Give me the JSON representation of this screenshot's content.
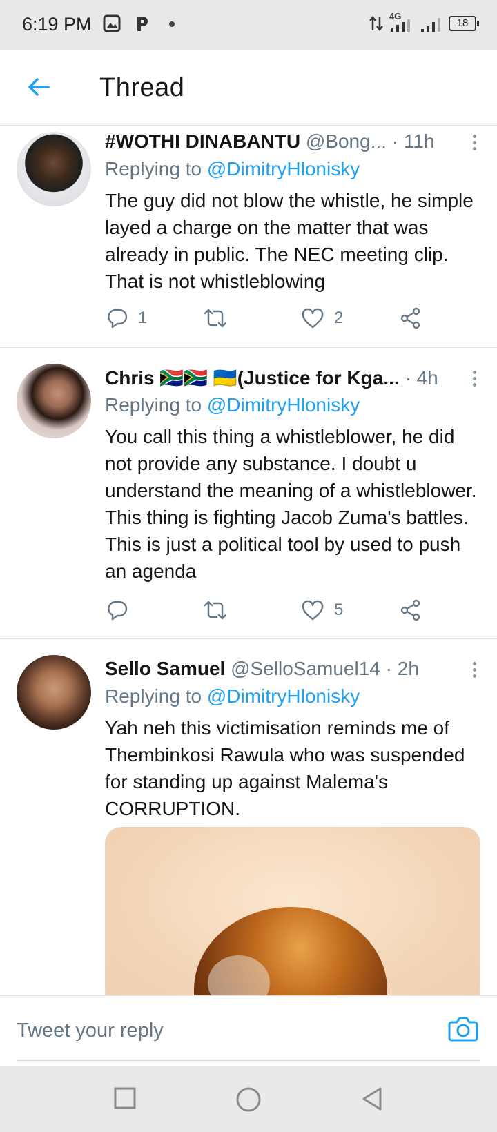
{
  "status_bar": {
    "time": "6:19 PM",
    "network": "4G",
    "battery": "18",
    "icons": [
      "gallery-icon",
      "p-icon",
      "dot-icon",
      "data-arrows-icon",
      "signal-icon",
      "signal-icon-2",
      "battery-icon"
    ]
  },
  "header": {
    "title": "Thread",
    "back_icon": "back-arrow-icon"
  },
  "colors": {
    "accent": "#1da1f2",
    "secondary_text": "#657786",
    "primary_text": "#14171a"
  },
  "tweets": [
    {
      "name": "#WOTHI DINABANTU",
      "handle": "@Bong...",
      "time": "· 11h",
      "replying_prefix": "Replying to ",
      "replying_to": "@DimitryHlonisky",
      "text": "The guy did not blow the whistle, he simple layed a charge on the matter that was already in public.  The NEC meeting clip.  That is not whistleblowing",
      "replies": "1",
      "retweets": "",
      "likes": "2"
    },
    {
      "name": "Chris 🇿🇦🇿🇦 🇺🇦(Justice for Kga...",
      "handle": "",
      "time": "· 4h",
      "replying_prefix": "Replying to ",
      "replying_to": "@DimitryHlonisky",
      "text": "You call this thing a whistleblower, he did not provide any substance. I doubt u understand the meaning of a whistleblower. This thing is fighting Jacob Zuma's battles. This is just a political tool by used to push an agenda",
      "replies": "",
      "retweets": "",
      "likes": "5"
    },
    {
      "name": "Sello Samuel",
      "handle": "@SelloSamuel14",
      "time": "· 2h",
      "replying_prefix": "Replying to ",
      "replying_to": "@DimitryHlonisky",
      "text": "Yah neh this victimisation reminds me of Thembinkosi Rawula who was suspended for standing up against Malema's CORRUPTION.",
      "replies": "",
      "retweets": "",
      "likes": ""
    }
  ],
  "reply_bar": {
    "placeholder": "Tweet your reply",
    "camera_icon": "camera-icon"
  },
  "nav_bar": {
    "icons": [
      "recents-icon",
      "home-icon",
      "back-icon"
    ]
  }
}
